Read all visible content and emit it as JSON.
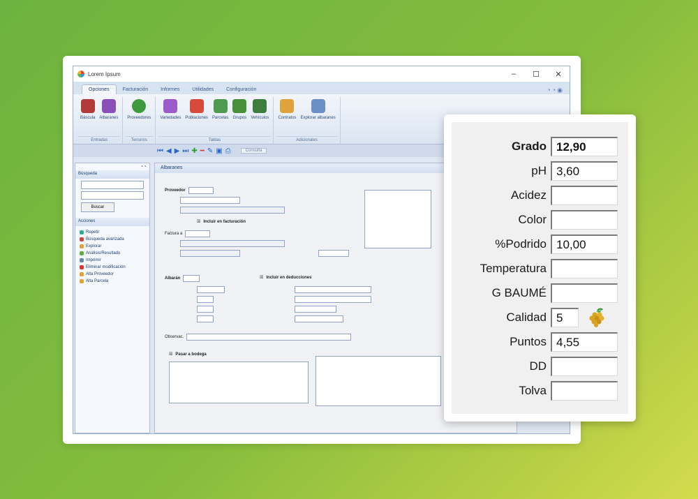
{
  "app": {
    "window_title": "Lorem Ipsum",
    "tabs": [
      "Opciones",
      "Facturación",
      "Informes",
      "Utilidades",
      "Configuración"
    ],
    "ribbon_groups": [
      {
        "label": "Entradas",
        "items": [
          "Báscula",
          "Albaranes"
        ]
      },
      {
        "label": "Terceros",
        "items": [
          "Proveedores"
        ]
      },
      {
        "label": "Tablas",
        "items": [
          "Variedades",
          "Poblaciones",
          "Parcelas",
          "Grupos",
          "Vehículos"
        ]
      },
      {
        "label": "Adicionales",
        "items": [
          "Contratos",
          "Explorar albaranes"
        ]
      }
    ],
    "consulta_label": "Consulta"
  },
  "sidebar": {
    "search_title": "Búsqueda",
    "search_button": "Buscar",
    "actions_title": "Acciones",
    "actions": [
      "Repetir",
      "Búsqueda avanzada",
      "Explorar",
      "Análisis/Resultado",
      "Imprimir",
      "Eliminar modificación",
      "Alta Proveedor",
      "Alta Parcela"
    ]
  },
  "form": {
    "title": "Albaranes",
    "proveedor_label": "Proveedor",
    "incluir_facturacion": "Incluir en facturación",
    "factura_label": "Factura a",
    "albaran_label": "Albarán",
    "incluir_deduplicados": "Incluir en deducciones",
    "pasar_bodega": "Pasar a bodega",
    "observaciones_label": "Observac."
  },
  "grade_panel": {
    "rows": [
      {
        "label": "Grado",
        "value": "12,90",
        "bold": true
      },
      {
        "label": "pH",
        "value": "3,60"
      },
      {
        "label": "Acidez",
        "value": ""
      },
      {
        "label": "Color",
        "value": ""
      },
      {
        "label": "%Podrido",
        "value": "10,00"
      },
      {
        "label": "Temperatura",
        "value": ""
      },
      {
        "label": "G BAUMÉ",
        "value": ""
      },
      {
        "label": "Calidad",
        "value": "5"
      },
      {
        "label": "Puntos",
        "value": "4,55"
      },
      {
        "label": "DD",
        "value": ""
      },
      {
        "label": "Tolva",
        "value": ""
      }
    ]
  },
  "colors": {
    "bg_start": "#6cb33f",
    "bg_end": "#d3dc4d",
    "ribbon_accent": "#2a66c6"
  }
}
